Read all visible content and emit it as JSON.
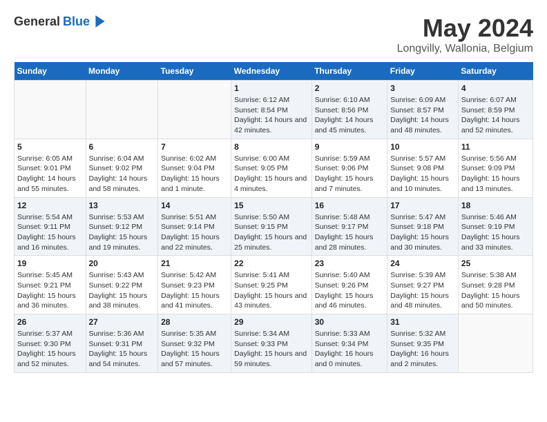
{
  "logo": {
    "general": "General",
    "blue": "Blue"
  },
  "title": "May 2024",
  "subtitle": "Longvilly, Wallonia, Belgium",
  "days_header": [
    "Sunday",
    "Monday",
    "Tuesday",
    "Wednesday",
    "Thursday",
    "Friday",
    "Saturday"
  ],
  "weeks": [
    [
      {
        "day": "",
        "sunrise": "",
        "sunset": "",
        "daylight": ""
      },
      {
        "day": "",
        "sunrise": "",
        "sunset": "",
        "daylight": ""
      },
      {
        "day": "",
        "sunrise": "",
        "sunset": "",
        "daylight": ""
      },
      {
        "day": "1",
        "sunrise": "Sunrise: 6:12 AM",
        "sunset": "Sunset: 8:54 PM",
        "daylight": "Daylight: 14 hours and 42 minutes."
      },
      {
        "day": "2",
        "sunrise": "Sunrise: 6:10 AM",
        "sunset": "Sunset: 8:56 PM",
        "daylight": "Daylight: 14 hours and 45 minutes."
      },
      {
        "day": "3",
        "sunrise": "Sunrise: 6:09 AM",
        "sunset": "Sunset: 8:57 PM",
        "daylight": "Daylight: 14 hours and 48 minutes."
      },
      {
        "day": "4",
        "sunrise": "Sunrise: 6:07 AM",
        "sunset": "Sunset: 8:59 PM",
        "daylight": "Daylight: 14 hours and 52 minutes."
      }
    ],
    [
      {
        "day": "5",
        "sunrise": "Sunrise: 6:05 AM",
        "sunset": "Sunset: 9:01 PM",
        "daylight": "Daylight: 14 hours and 55 minutes."
      },
      {
        "day": "6",
        "sunrise": "Sunrise: 6:04 AM",
        "sunset": "Sunset: 9:02 PM",
        "daylight": "Daylight: 14 hours and 58 minutes."
      },
      {
        "day": "7",
        "sunrise": "Sunrise: 6:02 AM",
        "sunset": "Sunset: 9:04 PM",
        "daylight": "Daylight: 15 hours and 1 minute."
      },
      {
        "day": "8",
        "sunrise": "Sunrise: 6:00 AM",
        "sunset": "Sunset: 9:05 PM",
        "daylight": "Daylight: 15 hours and 4 minutes."
      },
      {
        "day": "9",
        "sunrise": "Sunrise: 5:59 AM",
        "sunset": "Sunset: 9:06 PM",
        "daylight": "Daylight: 15 hours and 7 minutes."
      },
      {
        "day": "10",
        "sunrise": "Sunrise: 5:57 AM",
        "sunset": "Sunset: 9:08 PM",
        "daylight": "Daylight: 15 hours and 10 minutes."
      },
      {
        "day": "11",
        "sunrise": "Sunrise: 5:56 AM",
        "sunset": "Sunset: 9:09 PM",
        "daylight": "Daylight: 15 hours and 13 minutes."
      }
    ],
    [
      {
        "day": "12",
        "sunrise": "Sunrise: 5:54 AM",
        "sunset": "Sunset: 9:11 PM",
        "daylight": "Daylight: 15 hours and 16 minutes."
      },
      {
        "day": "13",
        "sunrise": "Sunrise: 5:53 AM",
        "sunset": "Sunset: 9:12 PM",
        "daylight": "Daylight: 15 hours and 19 minutes."
      },
      {
        "day": "14",
        "sunrise": "Sunrise: 5:51 AM",
        "sunset": "Sunset: 9:14 PM",
        "daylight": "Daylight: 15 hours and 22 minutes."
      },
      {
        "day": "15",
        "sunrise": "Sunrise: 5:50 AM",
        "sunset": "Sunset: 9:15 PM",
        "daylight": "Daylight: 15 hours and 25 minutes."
      },
      {
        "day": "16",
        "sunrise": "Sunrise: 5:48 AM",
        "sunset": "Sunset: 9:17 PM",
        "daylight": "Daylight: 15 hours and 28 minutes."
      },
      {
        "day": "17",
        "sunrise": "Sunrise: 5:47 AM",
        "sunset": "Sunset: 9:18 PM",
        "daylight": "Daylight: 15 hours and 30 minutes."
      },
      {
        "day": "18",
        "sunrise": "Sunrise: 5:46 AM",
        "sunset": "Sunset: 9:19 PM",
        "daylight": "Daylight: 15 hours and 33 minutes."
      }
    ],
    [
      {
        "day": "19",
        "sunrise": "Sunrise: 5:45 AM",
        "sunset": "Sunset: 9:21 PM",
        "daylight": "Daylight: 15 hours and 36 minutes."
      },
      {
        "day": "20",
        "sunrise": "Sunrise: 5:43 AM",
        "sunset": "Sunset: 9:22 PM",
        "daylight": "Daylight: 15 hours and 38 minutes."
      },
      {
        "day": "21",
        "sunrise": "Sunrise: 5:42 AM",
        "sunset": "Sunset: 9:23 PM",
        "daylight": "Daylight: 15 hours and 41 minutes."
      },
      {
        "day": "22",
        "sunrise": "Sunrise: 5:41 AM",
        "sunset": "Sunset: 9:25 PM",
        "daylight": "Daylight: 15 hours and 43 minutes."
      },
      {
        "day": "23",
        "sunrise": "Sunrise: 5:40 AM",
        "sunset": "Sunset: 9:26 PM",
        "daylight": "Daylight: 15 hours and 46 minutes."
      },
      {
        "day": "24",
        "sunrise": "Sunrise: 5:39 AM",
        "sunset": "Sunset: 9:27 PM",
        "daylight": "Daylight: 15 hours and 48 minutes."
      },
      {
        "day": "25",
        "sunrise": "Sunrise: 5:38 AM",
        "sunset": "Sunset: 9:28 PM",
        "daylight": "Daylight: 15 hours and 50 minutes."
      }
    ],
    [
      {
        "day": "26",
        "sunrise": "Sunrise: 5:37 AM",
        "sunset": "Sunset: 9:30 PM",
        "daylight": "Daylight: 15 hours and 52 minutes."
      },
      {
        "day": "27",
        "sunrise": "Sunrise: 5:36 AM",
        "sunset": "Sunset: 9:31 PM",
        "daylight": "Daylight: 15 hours and 54 minutes."
      },
      {
        "day": "28",
        "sunrise": "Sunrise: 5:35 AM",
        "sunset": "Sunset: 9:32 PM",
        "daylight": "Daylight: 15 hours and 57 minutes."
      },
      {
        "day": "29",
        "sunrise": "Sunrise: 5:34 AM",
        "sunset": "Sunset: 9:33 PM",
        "daylight": "Daylight: 15 hours and 59 minutes."
      },
      {
        "day": "30",
        "sunrise": "Sunrise: 5:33 AM",
        "sunset": "Sunset: 9:34 PM",
        "daylight": "Daylight: 16 hours and 0 minutes."
      },
      {
        "day": "31",
        "sunrise": "Sunrise: 5:32 AM",
        "sunset": "Sunset: 9:35 PM",
        "daylight": "Daylight: 16 hours and 2 minutes."
      },
      {
        "day": "",
        "sunrise": "",
        "sunset": "",
        "daylight": ""
      }
    ]
  ]
}
